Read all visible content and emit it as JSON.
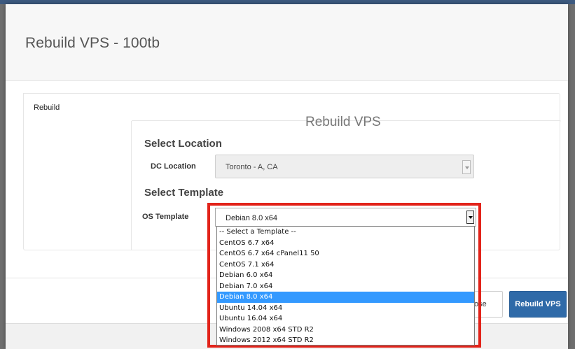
{
  "modal": {
    "title": "Rebuild VPS - 100tb",
    "tab_label": "Rebuild",
    "section_heading": "Rebuild VPS"
  },
  "location": {
    "heading": "Select Location",
    "field_label": "DC Location",
    "selected": "Toronto - A, CA"
  },
  "template": {
    "heading": "Select Template",
    "field_label": "OS Template",
    "selected": "Debian 8.0 x64",
    "options": [
      "-- Select a Template --",
      "CentOS 6.7 x64",
      "CentOS 6.7 x64 cPanel11 50",
      "CentOS 7.1 x64",
      "Debian 6.0 x64",
      "Debian 7.0 x64",
      "Debian 8.0 x64",
      "Ubuntu 14.04 x64",
      "Ubuntu 16.04 x64",
      "Windows 2008 x64 STD R2",
      "Windows 2012 x64 STD R2"
    ],
    "selected_index": 6
  },
  "footer": {
    "close_label": "Close",
    "close_visible_text": "ose",
    "rebuild_label": "Rebuild VPS"
  },
  "colors": {
    "primary": "#2f6aa8",
    "highlight": "#e2231a",
    "selection": "#3399ff"
  }
}
